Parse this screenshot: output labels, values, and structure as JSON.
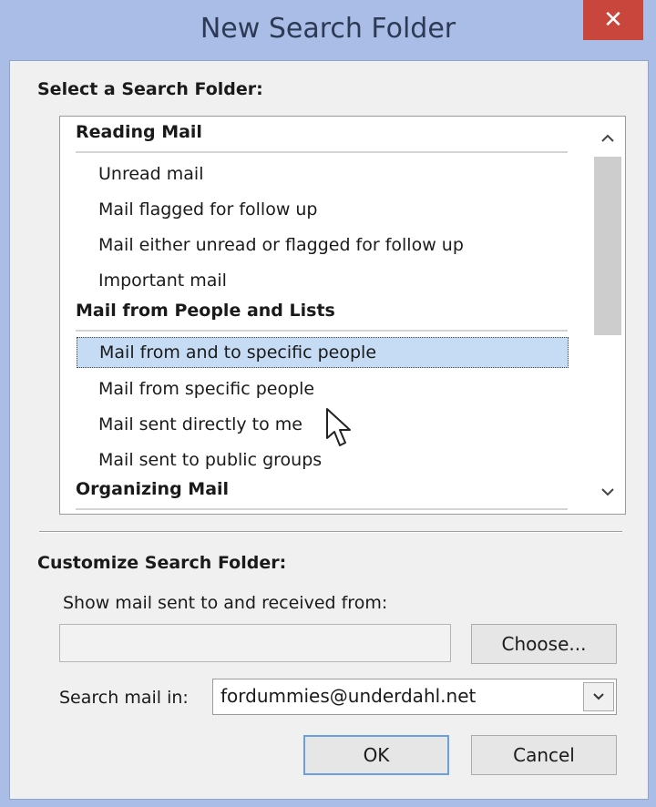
{
  "window": {
    "title": "New Search Folder",
    "close_glyph": "✕"
  },
  "select_section": {
    "label": "Select a Search Folder:"
  },
  "list": {
    "groups": [
      {
        "header": "Reading Mail",
        "items": [
          "Unread mail",
          "Mail flagged for follow up",
          "Mail either unread or flagged for follow up",
          "Important mail"
        ]
      },
      {
        "header": "Mail from People and Lists",
        "items": [
          "Mail from and to specific people",
          "Mail from specific people",
          "Mail sent directly to me",
          "Mail sent to public groups"
        ]
      },
      {
        "header": "Organizing Mail",
        "items": []
      }
    ],
    "selected_item": "Mail from and to specific people",
    "scroll_up_glyph": "⌃",
    "scroll_down_glyph": "⌄"
  },
  "customize_section": {
    "label": "Customize Search Folder:",
    "show_mail_label": "Show mail sent to and received from:",
    "show_mail_value": "",
    "choose_button": "Choose...",
    "search_in_label": "Search mail in:",
    "search_in_value": "fordummies@underdahl.net",
    "combo_arrow_glyph": "⌄"
  },
  "buttons": {
    "ok": "OK",
    "cancel": "Cancel"
  },
  "icons": {
    "close": "close-icon",
    "scroll_up": "chevron-up-icon",
    "scroll_down": "chevron-down-icon",
    "combo": "chevron-down-icon",
    "cursor": "mouse-pointer-icon"
  },
  "colors": {
    "titlebar": "#a9bde6",
    "close_button": "#c9463d",
    "selection": "#c6dcf5"
  }
}
